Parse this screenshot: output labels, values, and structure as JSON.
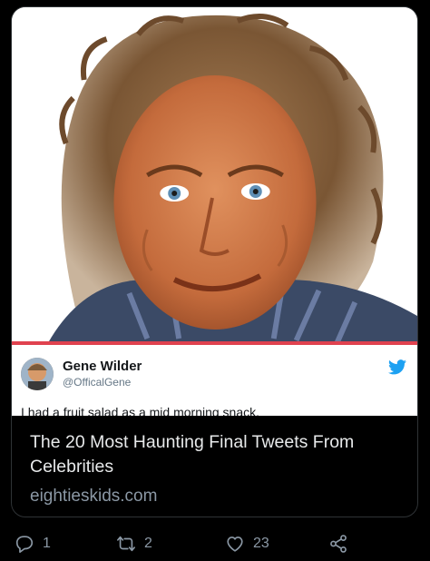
{
  "card": {
    "title": "The 20 Most Haunting Final Tweets From Celebrities",
    "domain": "eightieskids.com",
    "embedded_tweet": {
      "name": "Gene Wilder",
      "handle": "@OfficalGene",
      "text": "I had a fruit salad as a mid morning snack.",
      "bird_icon": "twitter-bird-icon"
    }
  },
  "actions": {
    "reply_count": "1",
    "retweet_count": "2",
    "like_count": "23",
    "icons": [
      "reply-icon",
      "retweet-icon",
      "like-icon",
      "share-icon"
    ]
  },
  "colors": {
    "background": "#000000",
    "text_primary": "#e7e9ea",
    "text_secondary": "#8b98a5",
    "twitter_blue": "#1da1f2",
    "accent_red": "#e0424f"
  }
}
